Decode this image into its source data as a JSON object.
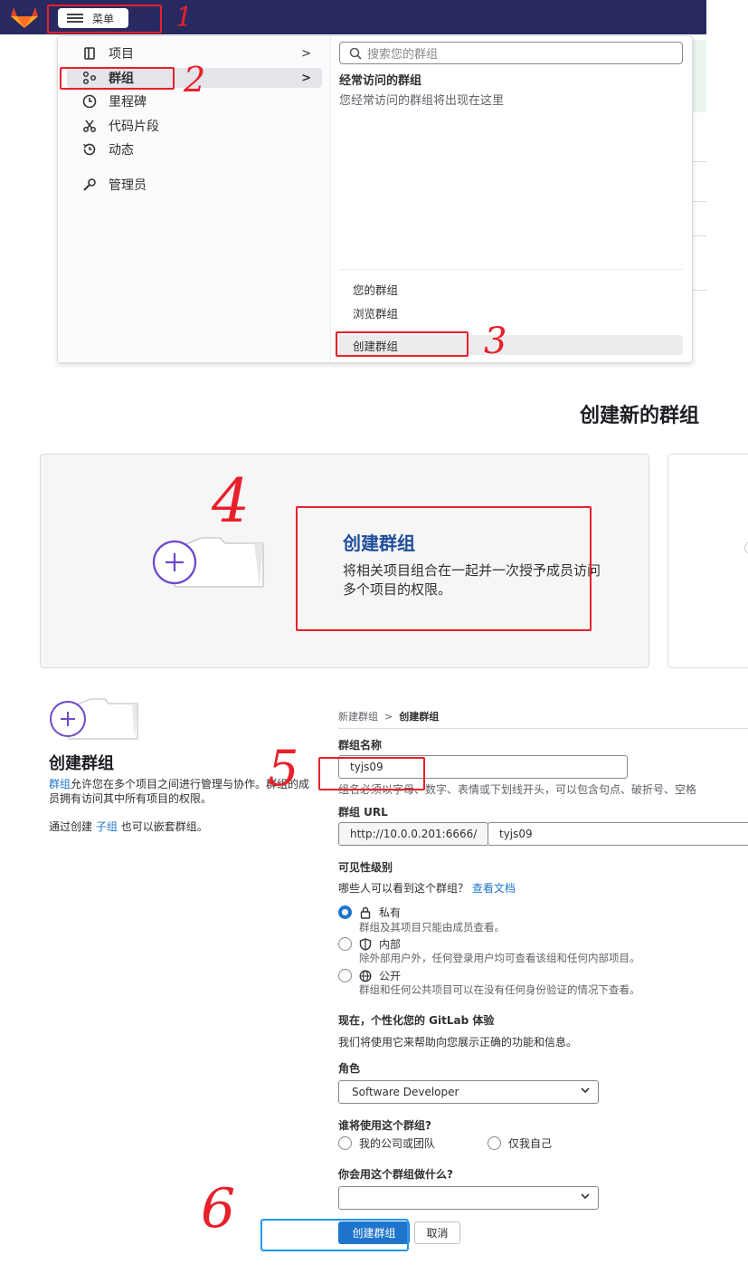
{
  "nav": {
    "menu_label": "菜单"
  },
  "dropdown": {
    "items": [
      {
        "label": "项目",
        "icon": "project-icon",
        "chevron": ">"
      },
      {
        "label": "群组",
        "icon": "group-icon",
        "chevron": ">"
      },
      {
        "label": "里程碑",
        "icon": "clock-icon"
      },
      {
        "label": "代码片段",
        "icon": "scissors-icon"
      },
      {
        "label": "动态",
        "icon": "history-icon"
      },
      {
        "label": "管理员",
        "icon": "admin-icon"
      }
    ],
    "search_placeholder": "搜索您的群组",
    "frequent_title": "经常访问的群组",
    "frequent_empty": "您经常访问的群组将出现在这里",
    "your_groups": "您的群组",
    "browse_groups": "浏览群组",
    "create_group": "创建群组"
  },
  "page": {
    "heading": "创建新的群组",
    "card_title": "创建群组",
    "card_desc": "将相关项目组合在一起并一次授予成员访问多个项目的权限。"
  },
  "form": {
    "side_title": "创建群组",
    "side_link": "群组",
    "side_text": "允许您在多个项目之间进行管理与协作。群组的成员拥有访问其中所有项目的权限。",
    "nest_pre": "通过创建",
    "nest_link": "子组",
    "nest_post": "也可以嵌套群组。",
    "breadcrumb_parent": "新建群组",
    "breadcrumb_sep": ">",
    "breadcrumb_current": "创建群组",
    "name_label": "群组名称",
    "name_value": "tyjs09",
    "name_help": "组名必须以字母、数字、表情或下划线开头，可以包含句点、破折号、空格",
    "url_label": "群组 URL",
    "url_prefix": "http://10.0.0.201:6666/",
    "url_value": "tyjs09",
    "visibility_label": "可见性级别",
    "visibility_question": "哪些人可以看到这个群组？",
    "visibility_doc_link": "查看文档",
    "visibility_options": [
      {
        "label": "私有",
        "icon": "lock-icon",
        "desc": "群组及其项目只能由成员查看。",
        "selected": true
      },
      {
        "label": "内部",
        "icon": "shield-icon",
        "desc": "除外部用户外，任何登录用户均可查看该组和任何内部项目。",
        "selected": false
      },
      {
        "label": "公开",
        "icon": "globe-icon",
        "desc": "群组和任何公共项目可以在没有任何身份验证的情况下查看。",
        "selected": false
      }
    ],
    "personalize_title": "现在，个性化您的 GitLab 体验",
    "personalize_text": "我们将使用它来帮助向您展示正确的功能和信息。",
    "role_label": "角色",
    "role_value": "Software Developer",
    "who_label": "谁将使用这个群组?",
    "who_options": [
      "我的公司或团队",
      "仅我自己"
    ],
    "purpose_label": "你会用这个群组做什么?",
    "purpose_value": "",
    "submit": "创建群组",
    "cancel": "取消"
  },
  "annotations": [
    "1",
    "2",
    "3",
    "4",
    "5",
    "6"
  ],
  "colors": {
    "nav_bg": "#292961",
    "primary": "#1f75cb",
    "annotation_red": "#e8202a",
    "annotation_blue": "#2196f3"
  }
}
